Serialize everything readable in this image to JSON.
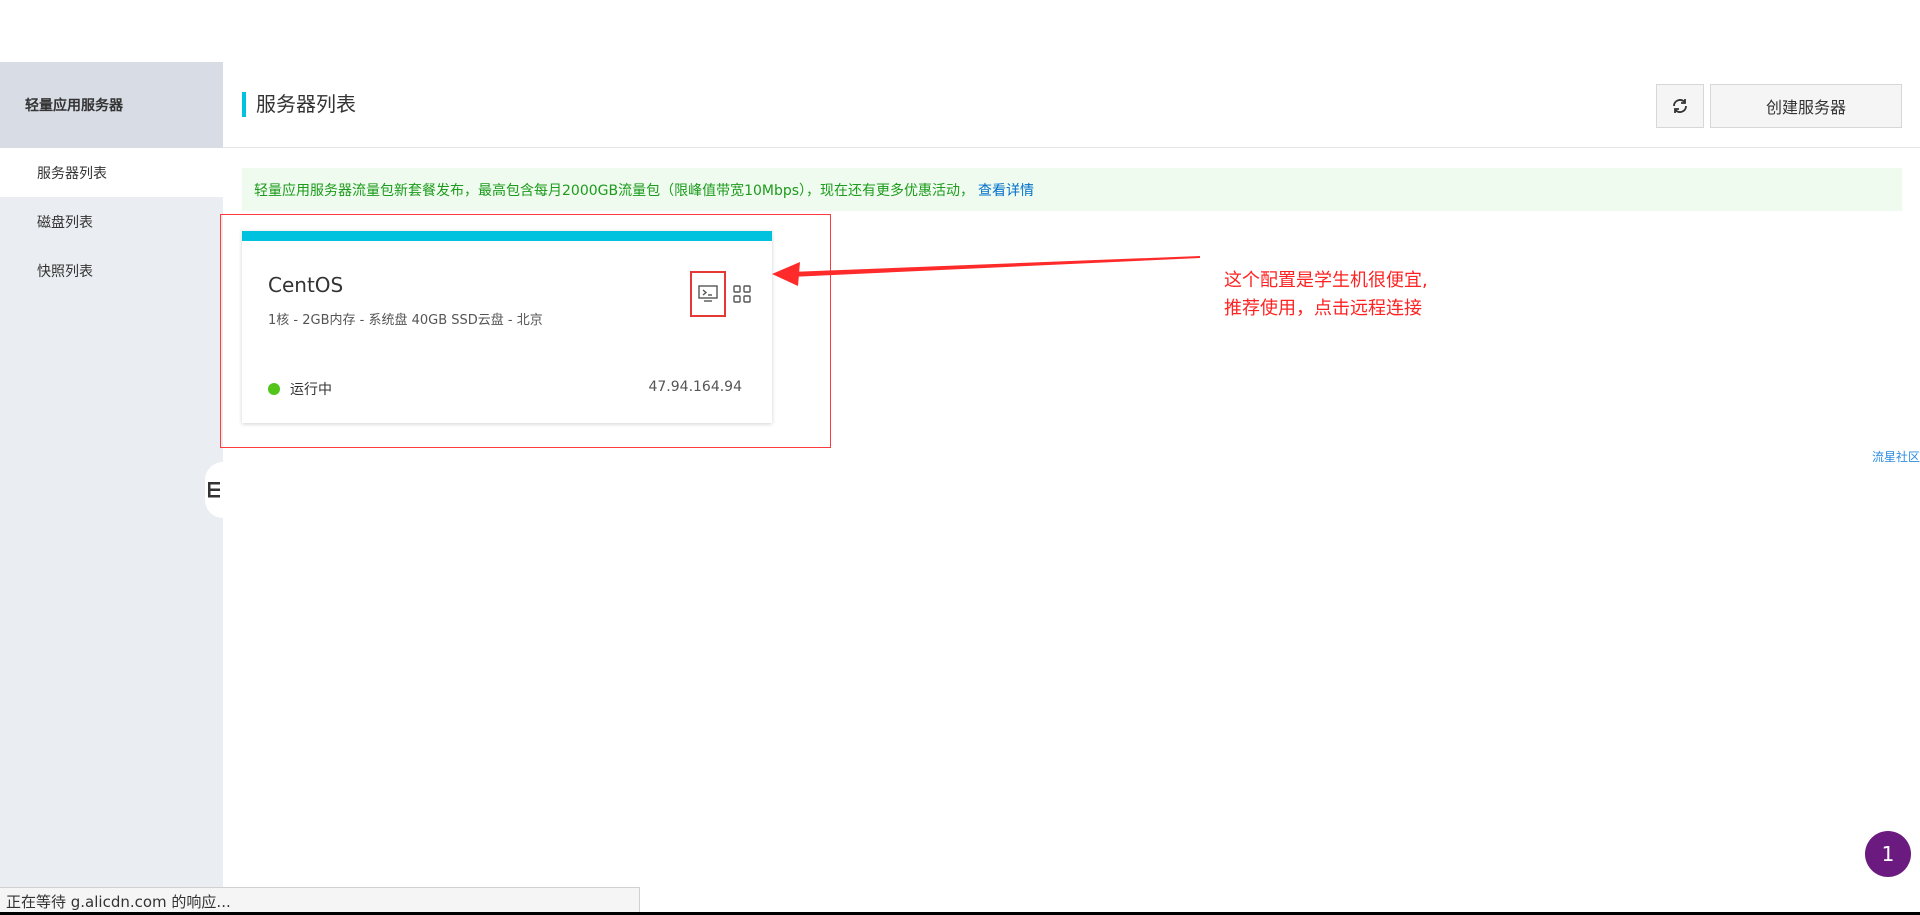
{
  "sidebar": {
    "title": "轻量应用服务器",
    "items": [
      {
        "label": "服务器列表",
        "active": true
      },
      {
        "label": "磁盘列表",
        "active": false
      },
      {
        "label": "快照列表",
        "active": false
      }
    ]
  },
  "header": {
    "title": "服务器列表",
    "refresh_icon": "refresh-icon",
    "create_label": "创建服务器"
  },
  "notice": {
    "text": "轻量应用服务器流量包新套餐发布，最高包含每月2000GB流量包（限峰值带宽10Mbps），现在还有更多优惠活动，",
    "link": "查看详情",
    "color": "#1c9b1c"
  },
  "server": {
    "name": "CentOS",
    "spec": "1核 - 2GB内存 - 系统盘 40GB SSD云盘 - 北京",
    "status": "运行中",
    "ip": "47.94.164.94",
    "accent": "#00c1de"
  },
  "annotation": {
    "line1": "这个配置是学生机很便宜,",
    "line2": "推荐使用，点击远程连接",
    "color": "#ff2222"
  },
  "community_link": "流星社区",
  "badge": "1",
  "statusbar": "正在等待 g.alicdn.com 的响应..."
}
